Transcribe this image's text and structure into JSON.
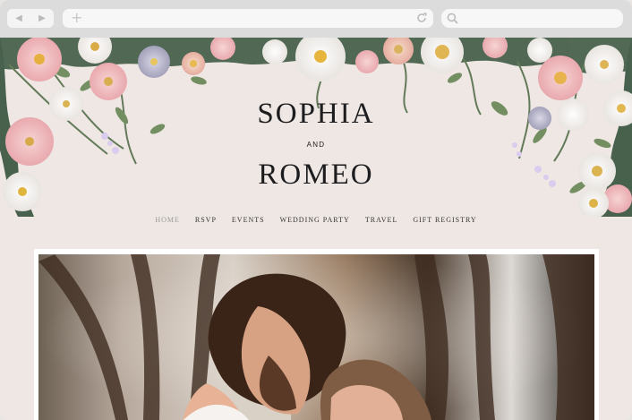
{
  "browser": {
    "back_icon": "back-icon",
    "forward_icon": "forward-icon",
    "new_tab_icon": "plus-icon",
    "reload_icon": "reload-icon",
    "search_icon": "search-icon"
  },
  "wedding": {
    "name_one": "SOPHIA",
    "and": "AND",
    "name_two": "ROMEO"
  },
  "nav": {
    "items": [
      "HOME",
      "RSVP",
      "EVENTS",
      "WEDDING PARTY",
      "TRAVEL",
      "GIFT REGISTRY"
    ],
    "active": "HOME"
  },
  "colors": {
    "page_bg": "#efe7e3",
    "text": "#1d1d1f",
    "active_nav": "#9a9a9a"
  }
}
